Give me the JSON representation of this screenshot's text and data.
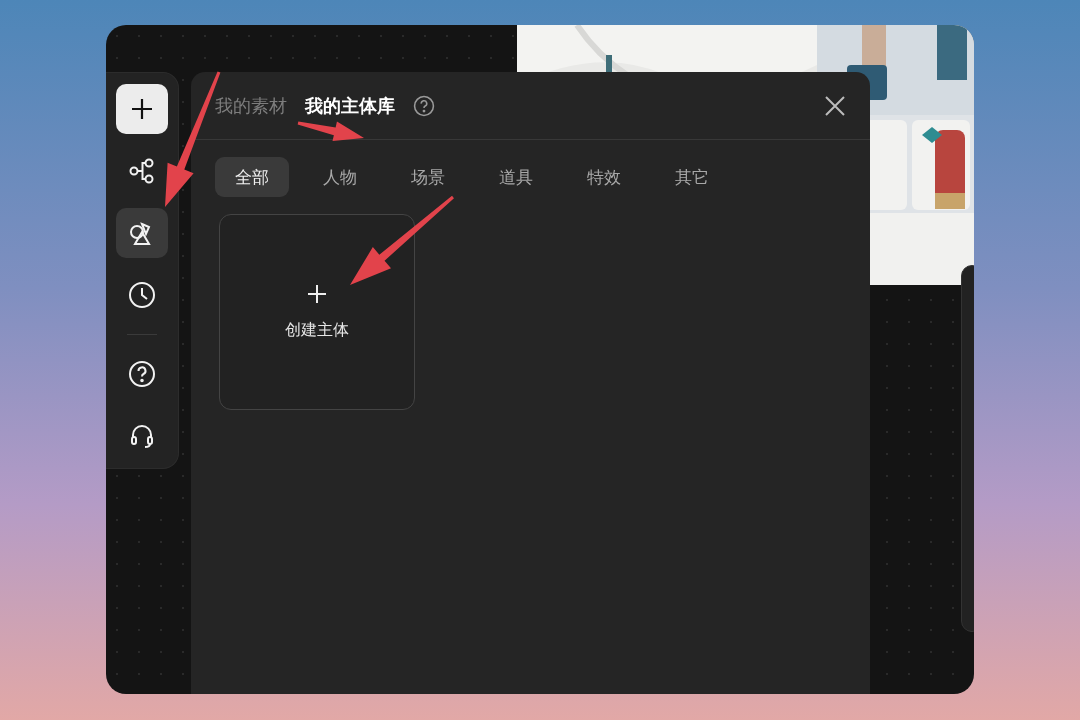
{
  "rail": {
    "top_items": [
      {
        "kind": "add"
      },
      {
        "kind": "flow",
        "selected": false
      },
      {
        "kind": "shapes",
        "selected": true
      },
      {
        "kind": "history",
        "selected": false
      }
    ],
    "bottom_items": [
      {
        "kind": "help",
        "selected": false
      },
      {
        "kind": "support",
        "selected": false
      }
    ]
  },
  "panel": {
    "tabs": [
      {
        "label": "我的素材",
        "selected": false
      },
      {
        "label": "我的主体库",
        "selected": true
      }
    ],
    "categories": [
      {
        "label": "全部",
        "selected": true
      },
      {
        "label": "人物",
        "selected": false
      },
      {
        "label": "场景",
        "selected": false
      },
      {
        "label": "道具",
        "selected": false
      },
      {
        "label": "特效",
        "selected": false
      },
      {
        "label": "其它",
        "selected": false
      }
    ],
    "create_card": {
      "label": "创建主体"
    }
  }
}
